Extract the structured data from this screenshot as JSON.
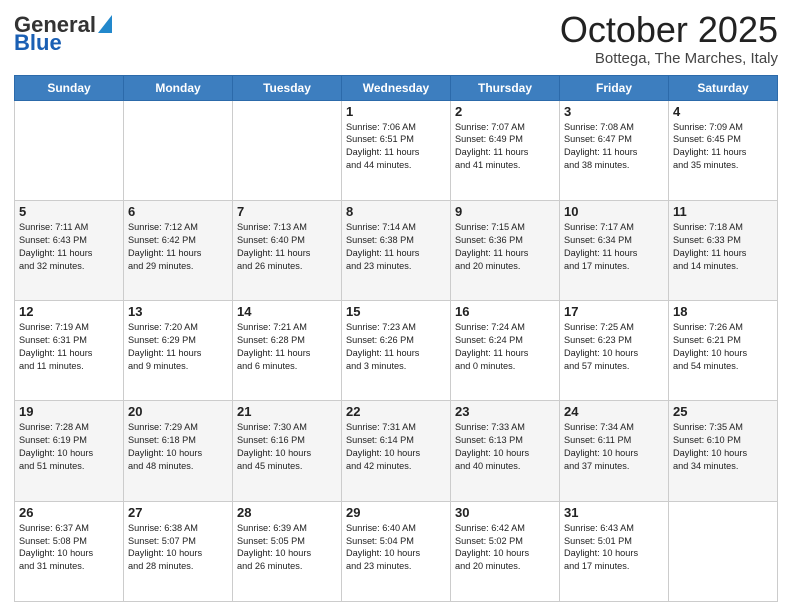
{
  "header": {
    "logo_general": "General",
    "logo_blue": "Blue",
    "month_title": "October 2025",
    "location": "Bottega, The Marches, Italy"
  },
  "days_of_week": [
    "Sunday",
    "Monday",
    "Tuesday",
    "Wednesday",
    "Thursday",
    "Friday",
    "Saturday"
  ],
  "weeks": [
    [
      {
        "day": "",
        "info": ""
      },
      {
        "day": "",
        "info": ""
      },
      {
        "day": "",
        "info": ""
      },
      {
        "day": "1",
        "info": "Sunrise: 7:06 AM\nSunset: 6:51 PM\nDaylight: 11 hours\nand 44 minutes."
      },
      {
        "day": "2",
        "info": "Sunrise: 7:07 AM\nSunset: 6:49 PM\nDaylight: 11 hours\nand 41 minutes."
      },
      {
        "day": "3",
        "info": "Sunrise: 7:08 AM\nSunset: 6:47 PM\nDaylight: 11 hours\nand 38 minutes."
      },
      {
        "day": "4",
        "info": "Sunrise: 7:09 AM\nSunset: 6:45 PM\nDaylight: 11 hours\nand 35 minutes."
      }
    ],
    [
      {
        "day": "5",
        "info": "Sunrise: 7:11 AM\nSunset: 6:43 PM\nDaylight: 11 hours\nand 32 minutes."
      },
      {
        "day": "6",
        "info": "Sunrise: 7:12 AM\nSunset: 6:42 PM\nDaylight: 11 hours\nand 29 minutes."
      },
      {
        "day": "7",
        "info": "Sunrise: 7:13 AM\nSunset: 6:40 PM\nDaylight: 11 hours\nand 26 minutes."
      },
      {
        "day": "8",
        "info": "Sunrise: 7:14 AM\nSunset: 6:38 PM\nDaylight: 11 hours\nand 23 minutes."
      },
      {
        "day": "9",
        "info": "Sunrise: 7:15 AM\nSunset: 6:36 PM\nDaylight: 11 hours\nand 20 minutes."
      },
      {
        "day": "10",
        "info": "Sunrise: 7:17 AM\nSunset: 6:34 PM\nDaylight: 11 hours\nand 17 minutes."
      },
      {
        "day": "11",
        "info": "Sunrise: 7:18 AM\nSunset: 6:33 PM\nDaylight: 11 hours\nand 14 minutes."
      }
    ],
    [
      {
        "day": "12",
        "info": "Sunrise: 7:19 AM\nSunset: 6:31 PM\nDaylight: 11 hours\nand 11 minutes."
      },
      {
        "day": "13",
        "info": "Sunrise: 7:20 AM\nSunset: 6:29 PM\nDaylight: 11 hours\nand 9 minutes."
      },
      {
        "day": "14",
        "info": "Sunrise: 7:21 AM\nSunset: 6:28 PM\nDaylight: 11 hours\nand 6 minutes."
      },
      {
        "day": "15",
        "info": "Sunrise: 7:23 AM\nSunset: 6:26 PM\nDaylight: 11 hours\nand 3 minutes."
      },
      {
        "day": "16",
        "info": "Sunrise: 7:24 AM\nSunset: 6:24 PM\nDaylight: 11 hours\nand 0 minutes."
      },
      {
        "day": "17",
        "info": "Sunrise: 7:25 AM\nSunset: 6:23 PM\nDaylight: 10 hours\nand 57 minutes."
      },
      {
        "day": "18",
        "info": "Sunrise: 7:26 AM\nSunset: 6:21 PM\nDaylight: 10 hours\nand 54 minutes."
      }
    ],
    [
      {
        "day": "19",
        "info": "Sunrise: 7:28 AM\nSunset: 6:19 PM\nDaylight: 10 hours\nand 51 minutes."
      },
      {
        "day": "20",
        "info": "Sunrise: 7:29 AM\nSunset: 6:18 PM\nDaylight: 10 hours\nand 48 minutes."
      },
      {
        "day": "21",
        "info": "Sunrise: 7:30 AM\nSunset: 6:16 PM\nDaylight: 10 hours\nand 45 minutes."
      },
      {
        "day": "22",
        "info": "Sunrise: 7:31 AM\nSunset: 6:14 PM\nDaylight: 10 hours\nand 42 minutes."
      },
      {
        "day": "23",
        "info": "Sunrise: 7:33 AM\nSunset: 6:13 PM\nDaylight: 10 hours\nand 40 minutes."
      },
      {
        "day": "24",
        "info": "Sunrise: 7:34 AM\nSunset: 6:11 PM\nDaylight: 10 hours\nand 37 minutes."
      },
      {
        "day": "25",
        "info": "Sunrise: 7:35 AM\nSunset: 6:10 PM\nDaylight: 10 hours\nand 34 minutes."
      }
    ],
    [
      {
        "day": "26",
        "info": "Sunrise: 6:37 AM\nSunset: 5:08 PM\nDaylight: 10 hours\nand 31 minutes."
      },
      {
        "day": "27",
        "info": "Sunrise: 6:38 AM\nSunset: 5:07 PM\nDaylight: 10 hours\nand 28 minutes."
      },
      {
        "day": "28",
        "info": "Sunrise: 6:39 AM\nSunset: 5:05 PM\nDaylight: 10 hours\nand 26 minutes."
      },
      {
        "day": "29",
        "info": "Sunrise: 6:40 AM\nSunset: 5:04 PM\nDaylight: 10 hours\nand 23 minutes."
      },
      {
        "day": "30",
        "info": "Sunrise: 6:42 AM\nSunset: 5:02 PM\nDaylight: 10 hours\nand 20 minutes."
      },
      {
        "day": "31",
        "info": "Sunrise: 6:43 AM\nSunset: 5:01 PM\nDaylight: 10 hours\nand 17 minutes."
      },
      {
        "day": "",
        "info": ""
      }
    ]
  ]
}
